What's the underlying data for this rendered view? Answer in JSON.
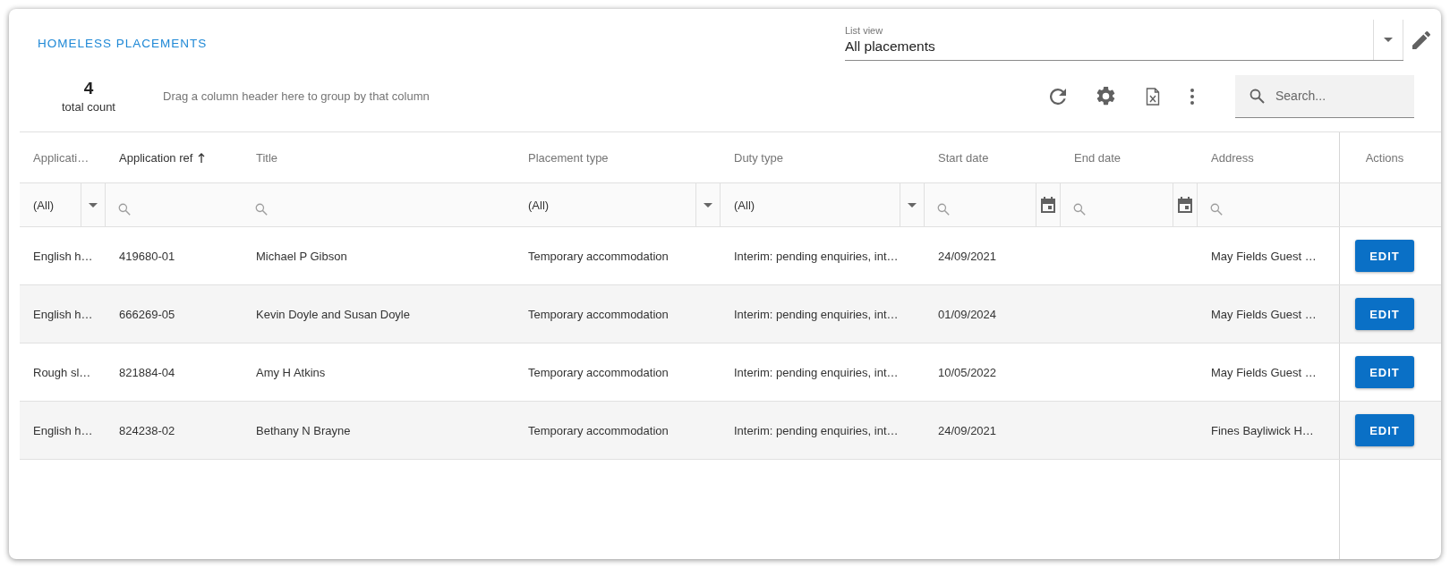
{
  "header": {
    "title": "HOMELESS PLACEMENTS",
    "list_view": {
      "label": "List view",
      "value": "All placements"
    }
  },
  "toolbar": {
    "count": "4",
    "count_label": "total count",
    "group_hint": "Drag a column header here to group by that column",
    "search": {
      "placeholder": "Search..."
    }
  },
  "table": {
    "columns": [
      {
        "label": "Applicati…",
        "sorted_ascending": false,
        "filter": {
          "kind": "select",
          "value": "(All)"
        }
      },
      {
        "label": "Application ref",
        "sorted_ascending": true,
        "filter": {
          "kind": "search"
        }
      },
      {
        "label": "Title",
        "sorted_ascending": false,
        "filter": {
          "kind": "search"
        }
      },
      {
        "label": "Placement type",
        "sorted_ascending": false,
        "filter": {
          "kind": "select",
          "value": "(All)"
        }
      },
      {
        "label": "Duty type",
        "sorted_ascending": false,
        "filter": {
          "kind": "select",
          "value": "(All)"
        }
      },
      {
        "label": "Start date",
        "sorted_ascending": false,
        "filter": {
          "kind": "date"
        }
      },
      {
        "label": "End date",
        "sorted_ascending": false,
        "filter": {
          "kind": "date"
        }
      },
      {
        "label": "Address",
        "sorted_ascending": false,
        "filter": {
          "kind": "search"
        }
      }
    ],
    "actions_header": "Actions",
    "rows": [
      {
        "cells": [
          "English h…",
          "419680-01",
          "Michael P Gibson",
          "Temporary accommodation",
          "Interim: pending enquiries, int…",
          "24/09/2021",
          "",
          "May Fields Guest …"
        ],
        "action": "EDIT"
      },
      {
        "cells": [
          "English h…",
          "666269-05",
          "Kevin Doyle and Susan Doyle",
          "Temporary accommodation",
          "Interim: pending enquiries, int…",
          "01/09/2024",
          "",
          "May Fields Guest …"
        ],
        "action": "EDIT"
      },
      {
        "cells": [
          "Rough sl…",
          "821884-04",
          "Amy H Atkins",
          "Temporary accommodation",
          "Interim: pending enquiries, int…",
          "10/05/2022",
          "",
          "May Fields Guest …"
        ],
        "action": "EDIT"
      },
      {
        "cells": [
          "English h…",
          "824238-02",
          "Bethany N Brayne",
          "Temporary accommodation",
          "Interim: pending enquiries, int…",
          "24/09/2021",
          "",
          "Fines Bayliwick H…"
        ],
        "action": "EDIT"
      }
    ]
  }
}
